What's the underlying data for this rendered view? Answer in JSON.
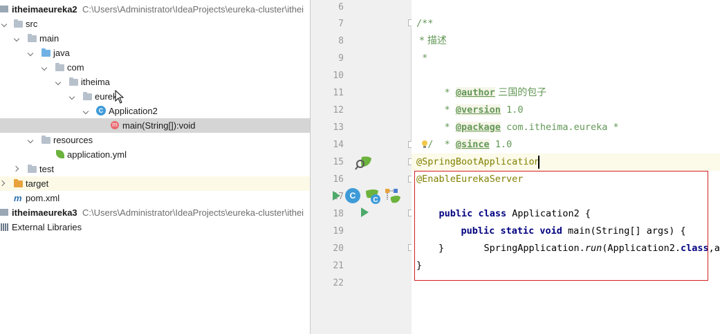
{
  "tree": {
    "module1": {
      "name": "itheimaeureka2",
      "path": "C:\\Users\\Administrator\\IdeaProjects\\eureka-cluster\\ithei"
    },
    "src": "src",
    "main": "main",
    "java": "java",
    "com": "com",
    "itheima": "itheima",
    "eureka": "eurek",
    "app_class": "Application2",
    "main_method": "main(String[]):void",
    "resources": "resources",
    "app_yml": "application.yml",
    "test": "test",
    "target": "target",
    "pom": "pom.xml",
    "module2": {
      "name": "itheimaeureka3",
      "path": "C:\\Users\\Administrator\\IdeaProjects\\eureka-cluster\\ithei"
    },
    "ext_libs": "External Libraries"
  },
  "gutter": {
    "line_numbers": [
      "6",
      "7",
      "8",
      "9",
      "10",
      "11",
      "12",
      "13",
      "14",
      "15",
      "16",
      "17",
      "18",
      "19",
      "20",
      "21",
      "22"
    ],
    "class_icon_letter": "C"
  },
  "code": {
    "l7": "/**",
    "l8": " * 描述",
    "l9": " *",
    "l10_pre": " * ",
    "l10_tag": "@author",
    "l10_val": " 三国的包子",
    "l11_tag": "@version",
    "l11_val": " 1.0",
    "l12_tag": "@package",
    "l12_val": " com.itheima.eureka *",
    "l13_tag": "@since",
    "l13_val": " 1.0",
    "l14": " */",
    "l15": "@SpringBootApplication",
    "l16": "@EnableEurekaServer",
    "l17_kw1": "public",
    "l17_kw2": "class",
    "l17_rest": " Application2 {",
    "l18_kw1": "public",
    "l18_kw2": "static",
    "l18_kw3": "void",
    "l18_rest": " main(String[] args) {",
    "l19_a": "SpringApplication.",
    "l19_run": "run",
    "l19_b": "(Application2.",
    "l19_kw": "class",
    "l19_c": ",args)",
    "l20": "}",
    "l21": "}"
  },
  "colors": {
    "comment": "#629755",
    "keyword": "#000080",
    "annotation": "#808000",
    "selection": "#d5d5d5",
    "highlight_box": "#d21f1f"
  }
}
